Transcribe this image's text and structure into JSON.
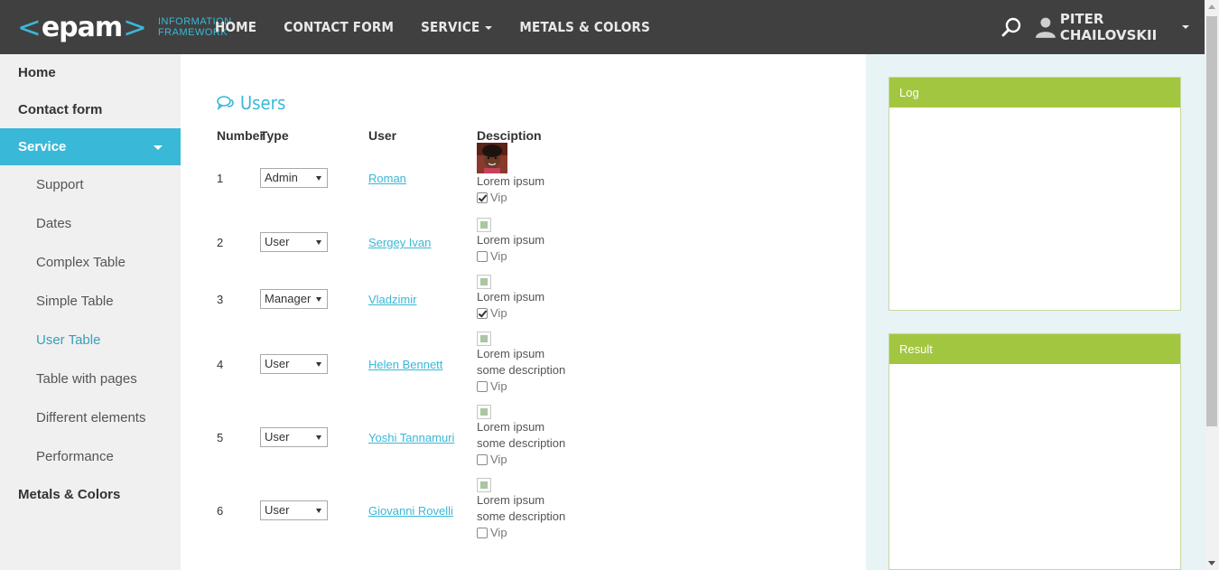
{
  "header": {
    "logo": "epam",
    "logo_sub1": "INFORMATION",
    "logo_sub2": "FRAMEWORK",
    "nav": [
      {
        "label": "HOME"
      },
      {
        "label": "CONTACT FORM"
      },
      {
        "label": "SERVICE",
        "dropdown": true
      },
      {
        "label": "METALS & COLORS"
      }
    ],
    "user_name": "PITER CHAILOVSKII"
  },
  "sidebar": {
    "items": [
      {
        "label": "Home"
      },
      {
        "label": "Contact form"
      },
      {
        "label": "Service"
      },
      {
        "label": "Metals & Colors"
      }
    ],
    "subitems": [
      {
        "label": "Support"
      },
      {
        "label": "Dates"
      },
      {
        "label": "Complex Table"
      },
      {
        "label": "Simple Table"
      },
      {
        "label": "User Table"
      },
      {
        "label": "Table with pages"
      },
      {
        "label": "Different elements"
      },
      {
        "label": "Performance"
      }
    ]
  },
  "main": {
    "title": "Users",
    "headers": {
      "number": "Number",
      "type": "Type",
      "user": "User",
      "description": "Desciption"
    },
    "rows": [
      {
        "num": "1",
        "type": "Admin",
        "user": "Roman",
        "desc1": "Lorem ipsum",
        "desc2": "",
        "vip_label": "Vip",
        "vip": true
      },
      {
        "num": "2",
        "type": "User",
        "user": "Sergey Ivan",
        "desc1": "Lorem ipsum",
        "desc2": "",
        "vip_label": "Vip",
        "vip": false
      },
      {
        "num": "3",
        "type": "Manager",
        "user": "Vladzimir",
        "desc1": "Lorem ipsum",
        "desc2": "",
        "vip_label": "Vip",
        "vip": true
      },
      {
        "num": "4",
        "type": "User",
        "user": "Helen Bennett",
        "desc1": "Lorem ipsum",
        "desc2": "some description",
        "vip_label": "Vip",
        "vip": false
      },
      {
        "num": "5",
        "type": "User",
        "user": "Yoshi Tannamuri",
        "desc1": "Lorem ipsum",
        "desc2": "some description",
        "vip_label": "Vip",
        "vip": false
      },
      {
        "num": "6",
        "type": "User",
        "user": "Giovanni Rovelli",
        "desc1": "Lorem ipsum",
        "desc2": "some description",
        "vip_label": "Vip",
        "vip": false
      }
    ]
  },
  "panels": {
    "log": "Log",
    "result": "Result"
  },
  "icons": {
    "search": "search-icon",
    "user": "user-icon",
    "users_title": "comments-icon"
  },
  "colors": {
    "header_bg": "#404041",
    "accent": "#3ab8d7",
    "panel_head": "#a3c640",
    "right_bg": "#e7f3f5"
  }
}
